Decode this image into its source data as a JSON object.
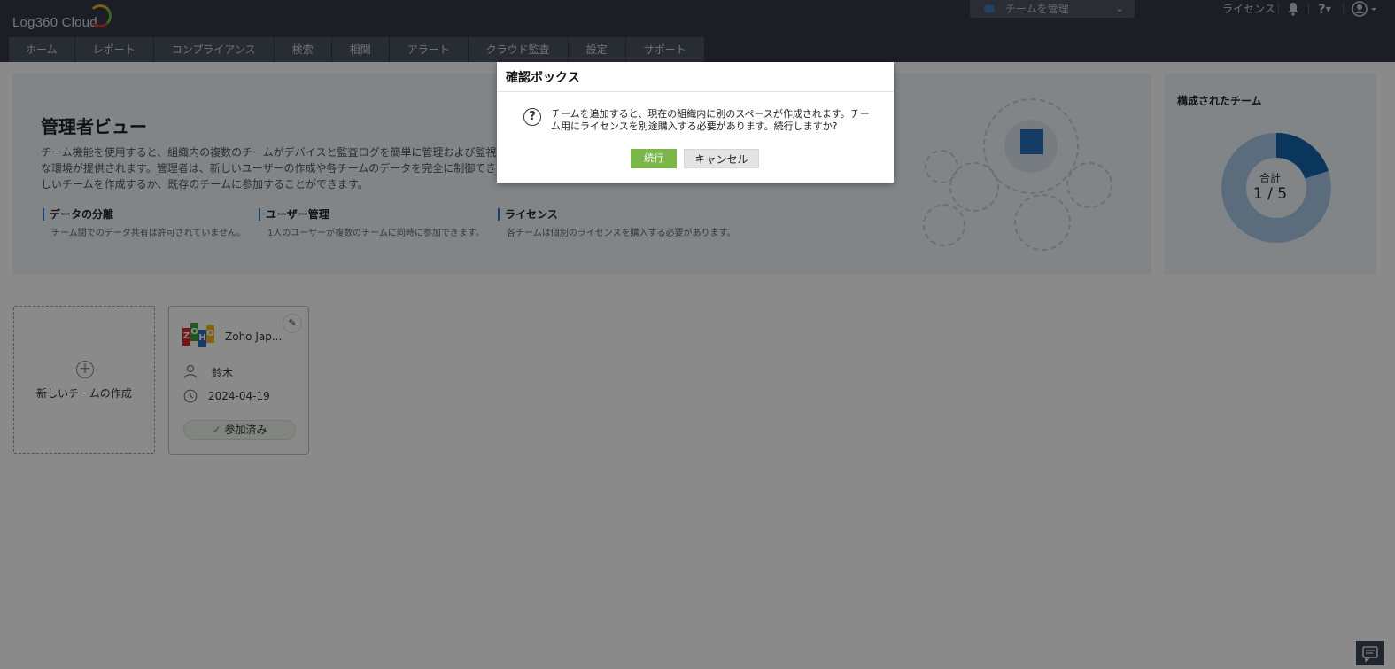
{
  "app": {
    "logo_text": "Log360  Cloud"
  },
  "header": {
    "team_selector_label": "チームを管理",
    "license_link": "ライセンス",
    "help_label": "?"
  },
  "nav": {
    "tabs": [
      {
        "label": "ホーム"
      },
      {
        "label": "レポート"
      },
      {
        "label": "コンプライアンス"
      },
      {
        "label": "検索"
      },
      {
        "label": "相関"
      },
      {
        "label": "アラート"
      },
      {
        "label": "クラウド監査"
      },
      {
        "label": "設定"
      },
      {
        "label": "サポート"
      }
    ]
  },
  "banner": {
    "title": "管理者ビュー",
    "description": "チーム機能を使用すると、組織内の複数のチームがデバイスと監査ログを簡単に管理および監視し、作業するための安全でプライベートな環境が提供されます。管理者は、新しいユーザーの作成や各チームのデータを完全に制御できます。以下のオプションを使用して、新しいチームを作成するか、既存のチームに参加することができます。",
    "features": [
      {
        "title": "データの分離",
        "desc": "チーム間でのデータ共有は許可されていません。"
      },
      {
        "title": "ユーザー管理",
        "desc": "1人のユーザーが複数のチームに同時に参加できます。"
      },
      {
        "title": "ライセンス",
        "desc": "各チームは個別のライセンスを購入する必要があります。"
      }
    ]
  },
  "team_panel": {
    "title": "構成されたチーム",
    "total_label": "合計",
    "total_value": "1 / 5",
    "used": 1,
    "max": 5,
    "colors": {
      "used": "#1565a8",
      "remaining": "#a9c9e6"
    }
  },
  "cards": {
    "new_team_label": "新しいチームの作成",
    "team": {
      "name": "Zoho Jap...",
      "owner": "鈴木",
      "date": "2024-04-19",
      "status": "参加済み"
    }
  },
  "dialog": {
    "title": "確認ボックス",
    "message": "チームを追加すると、現在の組織内に別のスペースが作成されます。チーム用にライセンスを別途購入する必要があります。続行しますか?",
    "continue_label": "続行",
    "cancel_label": "キャンセル"
  },
  "colors": {
    "topbar": "#333a45",
    "nav_tab": "#4b535f",
    "accent_green": "#7ab648",
    "accent_blue": "#2d7bc2"
  }
}
